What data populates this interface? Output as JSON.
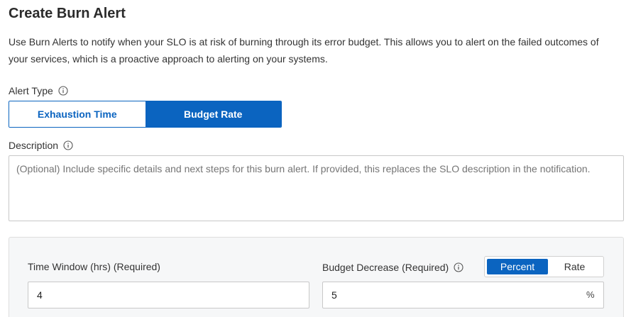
{
  "page": {
    "title": "Create Burn Alert",
    "intro": "Use Burn Alerts to notify when your SLO is at risk of burning through its error budget. This allows you to alert on the failed outcomes of your services, which is a proactive approach to alerting on your systems."
  },
  "alert_type": {
    "label": "Alert Type",
    "info_icon": "info-circle-icon",
    "options": [
      "Exhaustion Time",
      "Budget Rate"
    ],
    "selected": "Budget Rate"
  },
  "description": {
    "label": "Description",
    "info_icon": "info-circle-icon",
    "value": "",
    "placeholder": "(Optional) Include specific details and next steps for this burn alert. If provided, this replaces the SLO description in the notification."
  },
  "time_window": {
    "label": "Time Window (hrs) (Required)",
    "value": "4"
  },
  "budget_decrease": {
    "label": "Budget Decrease (Required)",
    "info_icon": "info-circle-icon",
    "value": "5",
    "suffix": "%",
    "unit_options": [
      "Percent",
      "Rate"
    ],
    "unit_selected": "Percent"
  },
  "colors": {
    "accent": "#0b64c0",
    "panel_bg": "#f6f7f8",
    "border": "#c8c8c8"
  }
}
